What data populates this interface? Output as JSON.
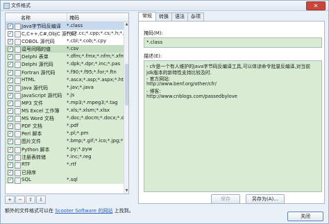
{
  "window": {
    "title": "文件格式",
    "close_label": "✕"
  },
  "list": {
    "col_name": "名称",
    "col_mask": "掩码",
    "rows": [
      {
        "name": "Java字节码反编译",
        "mask": "*.class",
        "checked": true,
        "state": "selected"
      },
      {
        "name": "C,C++,C#,ObjC 源代码",
        "mask": "*.c;*.cc;*.cpp;*.cs;*.h;*.hh",
        "checked": true,
        "state": ""
      },
      {
        "name": "COBOL 源代码",
        "mask": "*.cbl;*.cob;*.cpy",
        "checked": true,
        "state": ""
      },
      {
        "name": "逗号间隔的值",
        "mask": "*.csv",
        "checked": true,
        "state": "sel2"
      },
      {
        "name": "Delphi 表单",
        "mask": "*.dfm;*.fmx;*.nfm;*.xfm",
        "checked": true,
        "state": "alt"
      },
      {
        "name": "Delphi 源代码",
        "mask": "*.dpk;*.dpr;*.inc;*.pas",
        "checked": true,
        "state": "alt"
      },
      {
        "name": "Fortran 源代码",
        "mask": "*.f90;*.f95;*.for;*.ftn",
        "checked": true,
        "state": "alt"
      },
      {
        "name": "HTML",
        "mask": "*.ascx;*.asp;*.aspx;*.htm;*.html",
        "checked": true,
        "state": "alt"
      },
      {
        "name": "Java 源代码",
        "mask": "*.jav;*.java",
        "checked": true,
        "state": "alt"
      },
      {
        "name": "JavaScript 源代码",
        "mask": "*.js",
        "checked": true,
        "state": "alt"
      },
      {
        "name": "MP3 文件",
        "mask": "*.mp3;*.mpeg3;*.tag",
        "checked": true,
        "state": "alt"
      },
      {
        "name": "MS Excel 工作簿",
        "mask": "*.xls;*.xlsm;*.xlsx",
        "checked": true,
        "state": "alt"
      },
      {
        "name": "MS Word 文档",
        "mask": "*.doc;*.docm;*.docx;*.dot",
        "checked": true,
        "state": "alt"
      },
      {
        "name": "PDF 文档",
        "mask": "*.pdf",
        "checked": true,
        "state": "alt"
      },
      {
        "name": "Perl 脚本",
        "mask": "*.pl;*.pm",
        "checked": true,
        "state": "alt"
      },
      {
        "name": "图片文件",
        "mask": "*.bmp;*.gif;*.ico;*.jpg;*.jpeg",
        "checked": true,
        "state": "alt"
      },
      {
        "name": "Python 脚本",
        "mask": "*.py;*.pyw",
        "checked": true,
        "state": "alt"
      },
      {
        "name": "注册表转储",
        "mask": "*.inc;*.reg",
        "checked": true,
        "state": "alt"
      },
      {
        "name": "RTF",
        "mask": "*.rtf",
        "checked": true,
        "state": "alt"
      },
      {
        "name": "已排序",
        "mask": "",
        "checked": true,
        "state": "alt"
      },
      {
        "name": "SQL",
        "mask": "*.sql",
        "checked": true,
        "state": "alt"
      }
    ]
  },
  "toolbar": {
    "add": "+",
    "remove": "−",
    "up": "⇧",
    "down": "⇩"
  },
  "tabs": [
    "常规",
    "转换",
    "语法",
    "杂项"
  ],
  "general": {
    "mask_label": "掩码(M):",
    "mask_value": "*.class",
    "desc_label": "描述(E):",
    "desc_lines": [
      "- cfr是一个有人维护的java字节码反编译工具,可以体谅命令批量反编译,对当前",
      "jdk版本的新特性支持比较及时.",
      "- 官方网站:",
      "  http://www.benf.org/other/cfr/",
      "- 博客:",
      "http://www.cnblogs.com/passedbylove"
    ]
  },
  "buttons": {
    "save": "保存",
    "save_as": "另存为(A)...",
    "close": "关闭"
  },
  "status": {
    "prefix": "额外的文件格式可以在",
    "link": "Scooter Software 的网站",
    "suffix": "上找到。"
  }
}
